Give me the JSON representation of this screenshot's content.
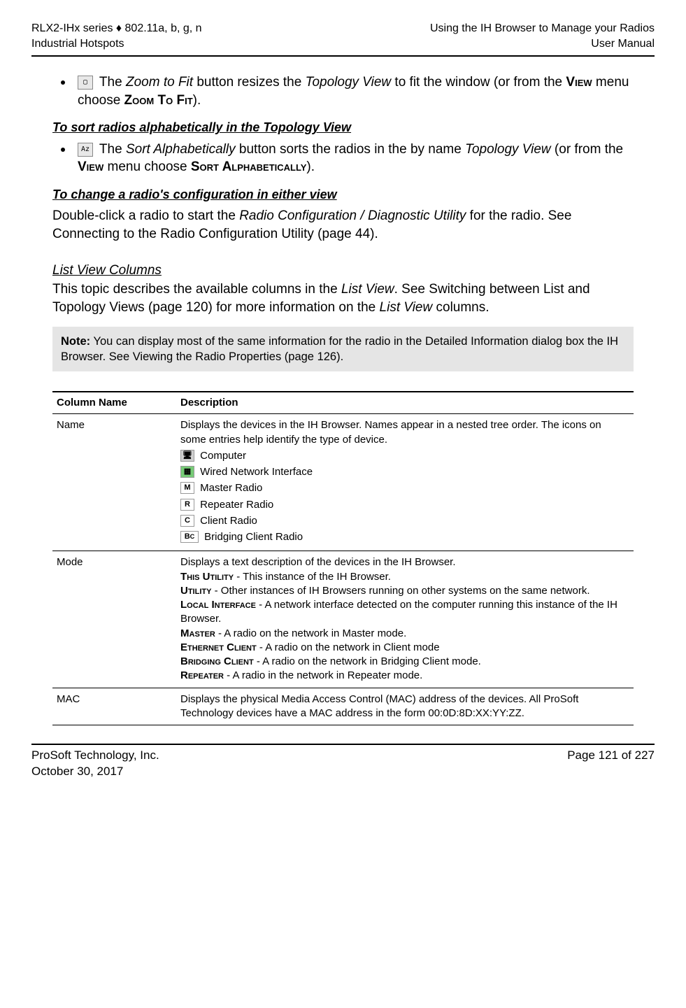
{
  "header": {
    "left1": "RLX2-IHx series ♦ 802.11a, b, g, n",
    "left2": "Industrial Hotspots",
    "right1": "Using the IH Browser to Manage your Radios",
    "right2": "User Manual"
  },
  "bullets": {
    "zoom": {
      "pre": " The ",
      "btn_name": "Zoom to Fit",
      "mid1": " button resizes the ",
      "view_name": "Topology View",
      "mid2": " to fit the window (or from the ",
      "menu1": "View",
      "mid3": " menu choose ",
      "menu_cmd": "Zoom To Fit",
      "end": ")."
    },
    "sort": {
      "pre": " The ",
      "btn_name": "Sort Alphabetically",
      "mid1": " button sorts the radios in the by name ",
      "view_name": "Topology View",
      "mid2": " (or from the ",
      "menu1": "View",
      "mid3": " menu choose ",
      "menu_cmd": "Sort Alphabetically",
      "end": ")."
    }
  },
  "headings": {
    "sort_head": "To sort radios alphabetically in the Topology View",
    "change_head": "To change a radio's configuration in either view",
    "list_head": "List View Columns"
  },
  "paragraphs": {
    "change_para_pre": "Double-click a radio to start the ",
    "change_para_em": "Radio Configuration / Diagnostic Utility",
    "change_para_post": " for the radio. See Connecting to the Radio Configuration Utility (page 44).",
    "list_para_pre": "This topic describes the available columns in the ",
    "list_para_em1": "List View",
    "list_para_mid": ". See Switching between List and Topology Views (page 120) for more information on the ",
    "list_para_em2": "List View",
    "list_para_post": " columns."
  },
  "note": {
    "label": "Note:",
    "text": " You can display most of the same information for the radio in the Detailed Information dialog box the IH Browser. See Viewing the Radio Properties (page 126)."
  },
  "table": {
    "th1": "Column Name",
    "th2": "Description",
    "rows": {
      "name": {
        "col1": "Name",
        "intro": "Displays the devices in the IH Browser. Names appear in a nested tree order. The icons on some entries help identify the type of device.",
        "icons": {
          "computer": "Computer",
          "wired": "Wired Network Interface",
          "master": "Master Radio",
          "repeater": "Repeater Radio",
          "client": "Client Radio",
          "bridging": "Bridging Client Radio"
        }
      },
      "mode": {
        "col1": "Mode",
        "intro": "Displays a text description of the devices in the IH Browser.",
        "items": [
          {
            "label": "This Utility",
            "text": " - This instance of the IH Browser."
          },
          {
            "label": "Utility",
            "text": " - Other instances of IH Browsers running on other systems on the same network."
          },
          {
            "label": "Local Interface",
            "text": " - A network interface detected on the computer running this instance of the IH Browser."
          },
          {
            "label": "Master",
            "text": " - A radio on the network in Master mode."
          },
          {
            "label": "Ethernet Client",
            "text": " - A radio on the network in Client mode"
          },
          {
            "label": "Bridging Client",
            "text": " - A radio on the network in Bridging Client mode."
          },
          {
            "label": "Repeater",
            "text": " - A radio in the network in Repeater mode."
          }
        ]
      },
      "mac": {
        "col1": "MAC",
        "text": "Displays the physical Media Access Control (MAC) address of the devices. All ProSoft Technology devices have a MAC address in the form 00:0D:8D:XX:YY:ZZ."
      }
    }
  },
  "footer": {
    "left1": "ProSoft Technology, Inc.",
    "left2": "October 30, 2017",
    "right": "Page 121 of 227"
  }
}
